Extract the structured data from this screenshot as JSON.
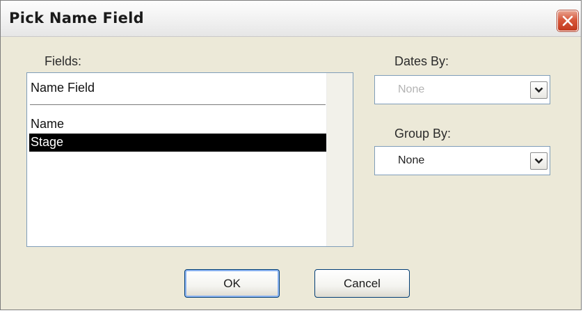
{
  "window": {
    "title": "Pick Name Field",
    "close_icon": "close-icon"
  },
  "fields": {
    "label": "Fields:",
    "header": "Name Field",
    "items": [
      {
        "label": "Name",
        "selected": false
      },
      {
        "label": "Stage",
        "selected": true
      }
    ]
  },
  "dates_by": {
    "label": "Dates By:",
    "value": "None",
    "enabled": false
  },
  "group_by": {
    "label": "Group By:",
    "value": "None",
    "enabled": true
  },
  "buttons": {
    "ok": "OK",
    "cancel": "Cancel"
  },
  "colors": {
    "dialog_bg": "#ece9d8",
    "selection_bg": "#000000",
    "selection_fg": "#ffffff",
    "close_red": "#d7583b"
  }
}
